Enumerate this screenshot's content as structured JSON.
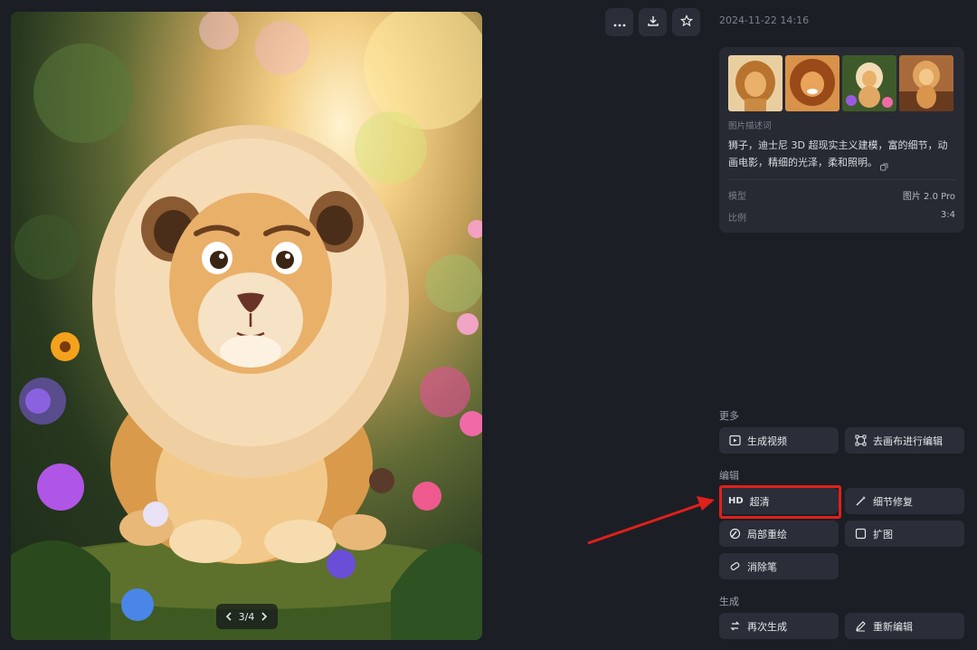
{
  "viewer": {
    "pager_text": "3/4"
  },
  "top_actions": [
    {
      "name": "more-options-button",
      "icon": "ellipsis-icon"
    },
    {
      "name": "download-button",
      "icon": "download-icon"
    },
    {
      "name": "favorite-button",
      "icon": "star-icon"
    }
  ],
  "info": {
    "timestamp": "2024-11-22 14:16",
    "description_title": "图片描述词",
    "description_text": "狮子，迪士尼 3D 超现实主义建模，富的细节，动画电影，精细的光泽，柔和照明。",
    "model_label": "模型",
    "model_value": "图片 2.0 Pro",
    "ratio_label": "比例",
    "ratio_value": "3:4"
  },
  "sections": {
    "more_title": "更多",
    "edit_title": "编辑",
    "generate_title": "生成"
  },
  "buttons": {
    "generate_video": "生成视频",
    "canvas_edit": "去画布进行编辑",
    "hd_prefix": "HD",
    "hd_label": "超清",
    "detail_fix": "细节修复",
    "partial_redraw": "局部重绘",
    "expand": "扩图",
    "eraser": "消除笔",
    "regenerate": "再次生成",
    "re_edit": "重新编辑"
  },
  "colors": {
    "background": "#1c1e26",
    "panel": "#272a33",
    "button": "#2b2e38",
    "annotation_red": "#e0201a"
  }
}
